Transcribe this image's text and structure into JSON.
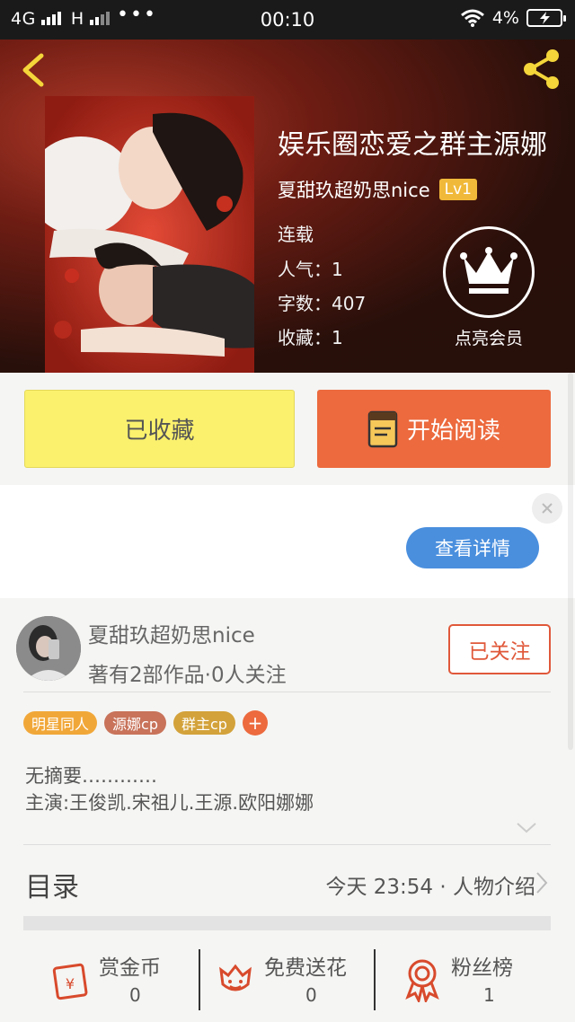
{
  "status_bar": {
    "network": "4G",
    "network2": "H",
    "dots": "•••",
    "time": "00:10",
    "battery": "4%"
  },
  "book": {
    "title": "娱乐圈恋爱之群主源娜",
    "author": "夏甜玖超奶思nice",
    "level": "Lv1",
    "status": "连载",
    "popularity": "人气：1",
    "word_count": "字数：407",
    "favorites": "收藏：1",
    "vip_label": "点亮会员"
  },
  "actions": {
    "favorite_label": "已收藏",
    "read_label": "开始阅读"
  },
  "ad": {
    "detail_label": "查看详情"
  },
  "author_card": {
    "name": "夏甜玖超奶思nice",
    "works": "著有2部作品·0人关注",
    "follow_label": "已关注"
  },
  "tags": [
    {
      "label": "明星同人",
      "color": "#f1a738"
    },
    {
      "label": "源娜cp",
      "color": "#c8735a"
    },
    {
      "label": "群主cp",
      "color": "#d3a23a"
    }
  ],
  "tag_add": "+",
  "summary": {
    "line1": "无摘要…………",
    "line2": "主演:王俊凯.宋祖儿.王源.欧阳娜娜"
  },
  "toc": {
    "title": "目录",
    "latest": "今天 23:54 · 人物介绍"
  },
  "stats": {
    "bounty_label": "赏金币",
    "bounty_value": "0",
    "flowers_label": "免费送花",
    "flowers_value": "0",
    "fans_label": "粉丝榜",
    "fans_value": "1"
  },
  "colors": {
    "accent": "#ec6a3e",
    "favorite_bg": "#fbf16d",
    "link_blue": "#4a8fde",
    "icon_red": "#d84a2c"
  }
}
